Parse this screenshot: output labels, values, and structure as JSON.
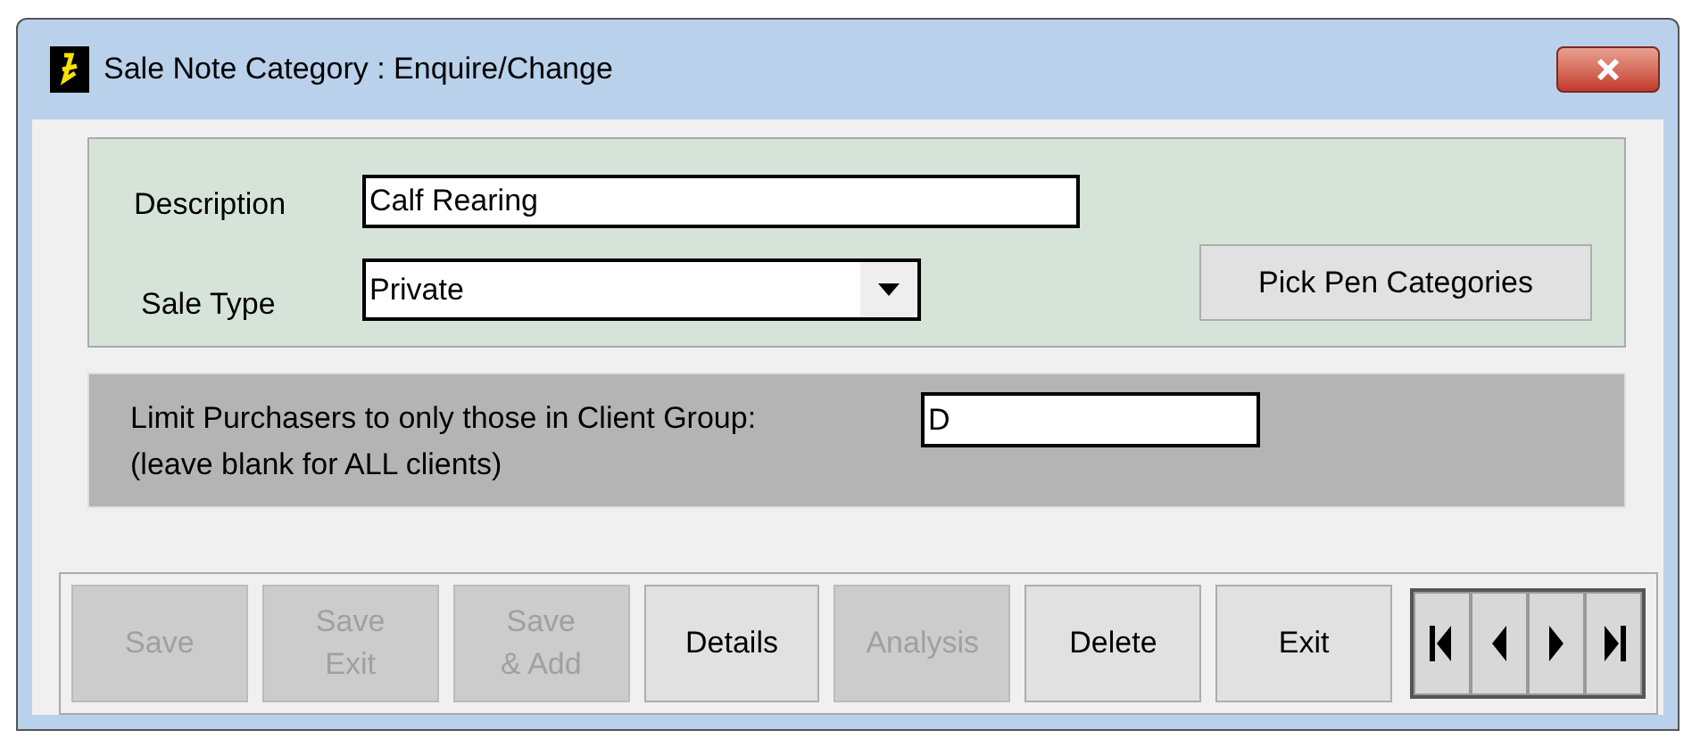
{
  "window": {
    "title": "Sale Note Category : Enquire/Change"
  },
  "form": {
    "description_label": "Description",
    "description_value": "Calf Rearing",
    "sale_type_label": "Sale Type",
    "sale_type_value": "Private",
    "pick_button": "Pick Pen Categories"
  },
  "client_group": {
    "label": "Limit Purchasers to only those in Client Group:",
    "hint": "(leave blank for ALL clients)",
    "value": "D"
  },
  "buttons": [
    {
      "lines": [
        "Save"
      ],
      "disabled": true
    },
    {
      "lines": [
        "Save",
        "Exit"
      ],
      "disabled": true
    },
    {
      "lines": [
        "Save",
        "& Add"
      ],
      "disabled": true
    },
    {
      "lines": [
        "Details"
      ],
      "disabled": false
    },
    {
      "lines": [
        "Analysis"
      ],
      "disabled": true
    },
    {
      "lines": [
        "Delete"
      ],
      "disabled": false
    },
    {
      "lines": [
        "Exit"
      ],
      "disabled": false
    }
  ],
  "navigation": [
    {
      "kind": "first"
    },
    {
      "kind": "previous"
    },
    {
      "kind": "next"
    },
    {
      "kind": "last"
    }
  ]
}
